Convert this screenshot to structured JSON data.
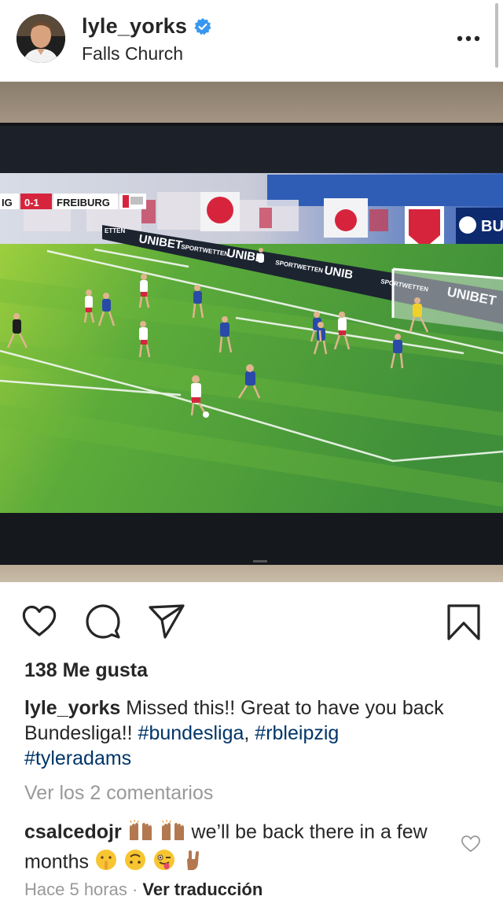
{
  "header": {
    "username": "lyle_yorks",
    "location": "Falls Church",
    "verified_color": "#3897f0"
  },
  "photo": {
    "scoreboard_left": "IG",
    "scoreboard_score": "0-1",
    "scoreboard_right": "FREIBURG",
    "board_texts": [
      "UNIBET",
      "SPORTWETTEN",
      "UNIBE",
      "SPORTWETTEN",
      "UNIB",
      "SPORTWETTEN",
      "UNIBET",
      "ETTEN",
      "BU"
    ]
  },
  "likes": "138 Me gusta",
  "caption": {
    "username": "lyle_yorks",
    "text": " Missed this!! Great to have you back Bundesliga!! ",
    "tag1": "#bundesliga",
    "separator": ", ",
    "tag2": "#rbleipzig",
    "tag3": "#tyleradams",
    "tag_color": "#003569"
  },
  "view_comments": "Ver los 2 comentarios",
  "comment": {
    "username": "csalcedojr",
    "text": " we’ll be back there in a few months"
  },
  "meta": {
    "time": "Hace 5 horas",
    "separator": " · ",
    "translate": "Ver traducción"
  },
  "icons": [
    "verified-icon",
    "more-options-icon",
    "heart-icon",
    "comment-icon",
    "share-icon",
    "bookmark-icon",
    "comment-like-heart-icon"
  ]
}
